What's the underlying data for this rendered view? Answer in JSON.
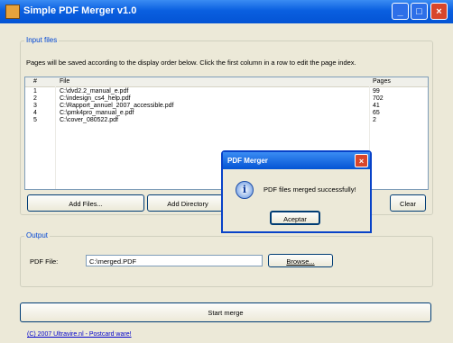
{
  "window": {
    "title": "Simple PDF Merger v1.0",
    "minimize": "_",
    "maximize": "□",
    "close": "×"
  },
  "input_files": {
    "label": "Input files",
    "note": "Pages will be saved according to the display order below. Click the first column in a row to edit the page index.",
    "columns": [
      "#",
      "File",
      "Pages"
    ],
    "rows": [
      {
        "index": "1",
        "file": "C:\\dvd2.2_manual_e.pdf",
        "pages": "99"
      },
      {
        "index": "2",
        "file": "C:\\indesign_cs4_help.pdf",
        "pages": "702"
      },
      {
        "index": "3",
        "file": "C:\\Rapport_annuel_2007_accessible.pdf",
        "pages": "41"
      },
      {
        "index": "4",
        "file": "C:\\pmk4pro_manual_e.pdf",
        "pages": "65"
      },
      {
        "index": "5",
        "file": "C:\\cover_080522.pdf",
        "pages": "2"
      }
    ],
    "buttons": {
      "add_files": "Add Files...",
      "add_directory": "Add Directory",
      "clear": "Clear"
    }
  },
  "output": {
    "label": "Output",
    "pdf_file_label": "PDF File:",
    "pdf_file_value": "C:\\merged.PDF",
    "browse": "Browse..."
  },
  "start_merge": "Start merge",
  "footer": {
    "copyright": "(C) 2007 Ultravire.nl - Postcard ware!"
  },
  "dialog": {
    "title": "PDF Merger",
    "close": "×",
    "icon": "i",
    "message": "PDF files merged successfully!",
    "ok": "Aceptar"
  },
  "colors": {
    "titlebar": "#0454d4",
    "group_label": "#0046d5",
    "close_button": "#d8462b",
    "background": "#ece9d8"
  }
}
